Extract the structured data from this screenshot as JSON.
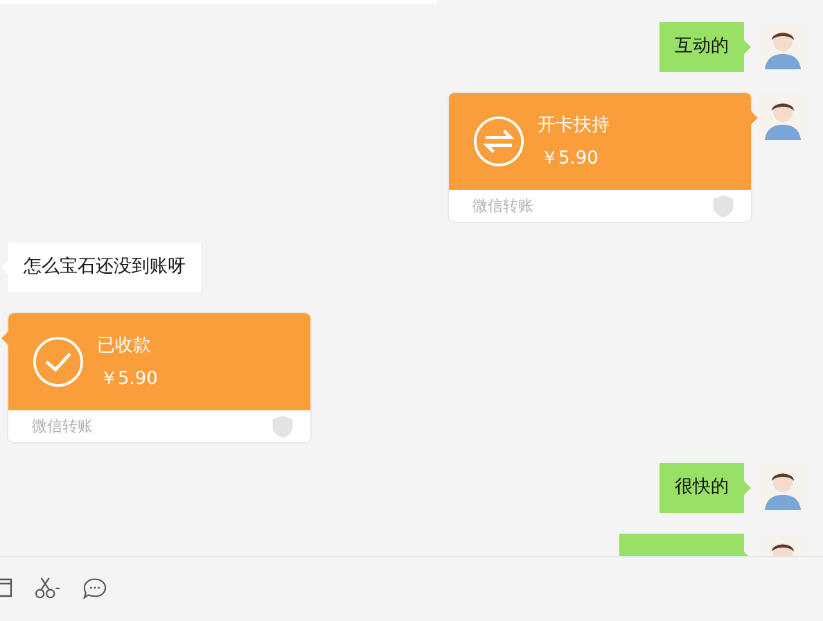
{
  "messages": [
    {
      "kind": "text",
      "outgoing": true,
      "text": "互动的"
    },
    {
      "kind": "transfer",
      "outgoing": true,
      "received": false,
      "title": "开卡扶持",
      "amount": "￥5.90",
      "footer": "微信转账"
    },
    {
      "kind": "text",
      "outgoing": false,
      "text": "怎么宝石还没到账呀"
    },
    {
      "kind": "transfer",
      "outgoing": false,
      "received": true,
      "title": "已收款",
      "amount": "￥5.90",
      "footer": "微信转账"
    },
    {
      "kind": "text",
      "outgoing": true,
      "text": "很快的"
    },
    {
      "kind": "cut",
      "outgoing": true
    }
  ]
}
